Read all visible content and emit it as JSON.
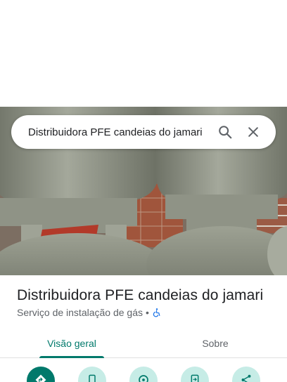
{
  "search": {
    "value": "Distribuidora PFE candeias do jamari"
  },
  "place": {
    "name": "Distribuidora PFE candeias do jamari",
    "category": "Serviço de instalação de gás",
    "separator": "•"
  },
  "tabs": [
    {
      "label": "Visão geral",
      "active": true
    },
    {
      "label": "Sobre",
      "active": false
    }
  ],
  "actions": [
    {
      "icon": "directions-icon"
    },
    {
      "icon": "phone-icon"
    },
    {
      "icon": "nearby-icon"
    },
    {
      "icon": "send-to-phone-icon"
    },
    {
      "icon": "share-icon"
    }
  ],
  "colors": {
    "accent": "#00796b",
    "action_bg": "#c6ece6",
    "accessibility": "#1a73e8"
  }
}
